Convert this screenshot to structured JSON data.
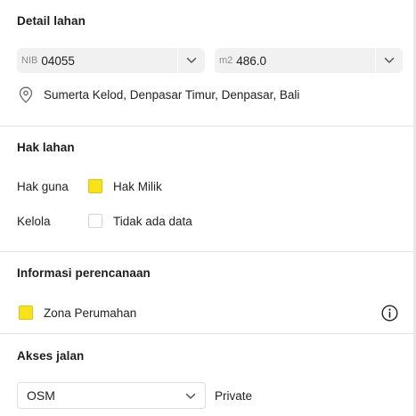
{
  "detail": {
    "title": "Detail lahan",
    "nib_prefix": "NIB",
    "nib_value": "04055",
    "area_prefix": "m2",
    "area_value": "486.0",
    "location": "Sumerta Kelod, Denpasar Timur, Denpasar, Bali"
  },
  "hak": {
    "title": "Hak lahan",
    "rows": [
      {
        "label": "Hak guna",
        "value": "Hak Milik",
        "color": "#f7e21b"
      },
      {
        "label": "Kelola",
        "value": "Tidak ada data",
        "color": "#ffffff"
      }
    ]
  },
  "perencanaan": {
    "title": "Informasi perencanaan",
    "zone_label": "Zona Perumahan",
    "zone_color": "#f7e21b",
    "info_icon": "info-icon"
  },
  "akses": {
    "title": "Akses jalan",
    "source_value": "OSM",
    "access_type": "Private"
  }
}
